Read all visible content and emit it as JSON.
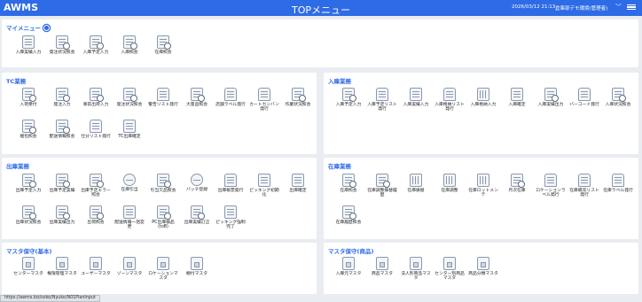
{
  "header": {
    "brand": "AWMS",
    "title": "TOPメニュー",
    "datetime": "2026/03/12 21:13",
    "user": "倉庫部デモ環境(管理者)",
    "bg_color": "#2e6be6"
  },
  "panels": {
    "mymenu": {
      "title": "マイメニュー",
      "items": [
        {
          "label": "入庫実績入力",
          "icon": "clipboard-icon"
        },
        {
          "label": "発注状況照会",
          "icon": "document-search-icon"
        },
        {
          "label": "入庫予定入力",
          "icon": "document-search-icon"
        },
        {
          "label": "入庫照会",
          "icon": "document-search-icon"
        },
        {
          "label": "在庫照会",
          "icon": "document-search-icon"
        }
      ]
    },
    "tc": {
      "title": "TC業務",
      "items": [
        {
          "label": "入荷受付",
          "icon": "document-search-icon"
        },
        {
          "label": "発注入力",
          "icon": "document-search-icon"
        },
        {
          "label": "事前出荷入力",
          "icon": "document-search-icon"
        },
        {
          "label": "発注状況照会",
          "icon": "document-search-icon"
        },
        {
          "label": "警告リスト発行",
          "icon": "printer-icon"
        },
        {
          "label": "大量品照会",
          "icon": "document-search-icon"
        },
        {
          "label": "店舗ラベル発行",
          "icon": "printer-icon"
        },
        {
          "label": "カートカンバン発行",
          "icon": "printer-icon"
        },
        {
          "label": "作業状況照会",
          "icon": "document-search-icon"
        },
        {
          "label": "梱包照会",
          "icon": "document-search-icon"
        },
        {
          "label": "配送情報照会",
          "icon": "document-search-icon"
        },
        {
          "label": "仕分リスト発行",
          "icon": "printer-icon"
        },
        {
          "label": "TC出庫確定",
          "icon": "document-icon"
        }
      ]
    },
    "inbound": {
      "title": "入庫業務",
      "items": [
        {
          "label": "入庫予定入力",
          "icon": "document-search-icon"
        },
        {
          "label": "入庫予定リスト発行",
          "icon": "printer-icon"
        },
        {
          "label": "入庫実績入力",
          "icon": "clipboard-icon"
        },
        {
          "label": "入庫格納リスト発行",
          "icon": "printer-icon"
        },
        {
          "label": "入庫格納入力",
          "icon": "grid-icon"
        },
        {
          "label": "入庫確定",
          "icon": "document-icon"
        },
        {
          "label": "入庫実績出力",
          "icon": "document-export-icon"
        },
        {
          "label": "バーコード発行",
          "icon": "printer-icon"
        },
        {
          "label": "入庫状況照会",
          "icon": "document-search-icon"
        }
      ]
    },
    "outbound": {
      "title": "出庫業務",
      "items": [
        {
          "label": "出庫予定入力",
          "icon": "document-search-icon"
        },
        {
          "label": "出庫予定実績",
          "icon": "document-search-icon"
        },
        {
          "label": "出庫予定エラー照会",
          "icon": "document-search-icon"
        },
        {
          "label": "在庫引当",
          "icon": "magnifier-icon"
        },
        {
          "label": "引当欠品照会",
          "icon": "document-search-icon"
        },
        {
          "label": "バッチ登録",
          "icon": "magnifier-icon"
        },
        {
          "label": "出庫帳票発行",
          "icon": "printer-icon"
        },
        {
          "label": "ピッキング初期化",
          "icon": "clipboard-icon"
        },
        {
          "label": "出庫確定",
          "icon": "document-icon"
        },
        {
          "label": "出庫状況照会",
          "icon": "document-search-icon"
        },
        {
          "label": "出庫実績出力",
          "icon": "document-export-icon"
        },
        {
          "label": "出荷照会",
          "icon": "document-search-icon"
        },
        {
          "label": "配送情報一括変更",
          "icon": "document-icon"
        },
        {
          "label": "PC出庫検品(toB)",
          "icon": "document-search-icon"
        },
        {
          "label": "出庫実績訂正",
          "icon": "document-search-icon"
        },
        {
          "label": "ピッキング強制完了",
          "icon": "document-icon"
        }
      ]
    },
    "inventory": {
      "title": "在庫業務",
      "items": [
        {
          "label": "在庫照会",
          "icon": "document-search-icon"
        },
        {
          "label": "在庫調整振替履歴",
          "icon": "document-search-icon"
        },
        {
          "label": "在庫振替",
          "icon": "grid-icon"
        },
        {
          "label": "在庫調整",
          "icon": "grid-icon"
        },
        {
          "label": "在庫ロットメンテ",
          "icon": "grid-icon"
        },
        {
          "label": "月次在庫",
          "icon": "document-search-icon"
        },
        {
          "label": "ロケーションラベル発行",
          "icon": "printer-icon"
        },
        {
          "label": "在庫補充リスト発行",
          "icon": "printer-icon"
        },
        {
          "label": "在庫ラベル発行",
          "icon": "printer-icon"
        },
        {
          "label": "在庫履歴照会",
          "icon": "document-search-icon"
        }
      ]
    },
    "master_basic": {
      "title": "マスタ保守(基本)",
      "items": [
        {
          "label": "センターマスタ",
          "icon": "tag-icon"
        },
        {
          "label": "権限管理マスタ",
          "icon": "tag-icon"
        },
        {
          "label": "ユーザーマスタ",
          "icon": "tag-icon"
        },
        {
          "label": "ゾーンマスタ",
          "icon": "tag-icon"
        },
        {
          "label": "ロケーションマスタ",
          "icon": "tag-icon"
        },
        {
          "label": "棚付マスタ",
          "icon": "tag-icon"
        }
      ]
    },
    "master_goods": {
      "title": "マスタ保守(商品)",
      "items": [
        {
          "label": "入庫元マスタ",
          "icon": "tag-icon"
        },
        {
          "label": "商品マスタ",
          "icon": "tag-icon"
        },
        {
          "label": "法人別商品マスタ",
          "icon": "tag-icon"
        },
        {
          "label": "センター別商品マスタ",
          "icon": "tag-icon"
        },
        {
          "label": "商品分類マスタ",
          "icon": "tag-icon"
        }
      ]
    }
  },
  "status_url": "https://awms.biz/soko/Nyuko/N01PlanInput"
}
